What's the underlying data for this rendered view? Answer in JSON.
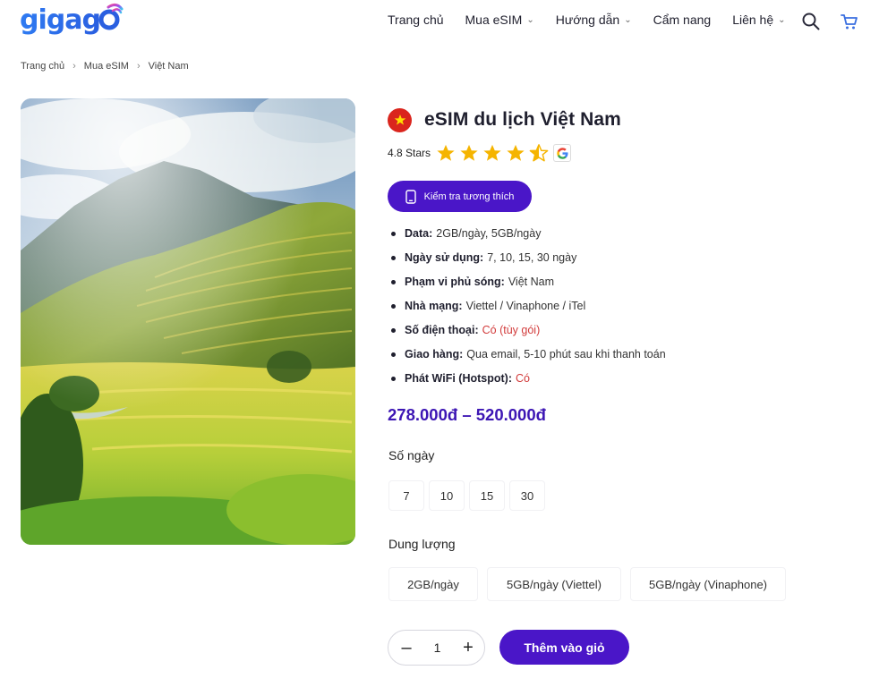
{
  "brand": {
    "logo_text": "gigago",
    "accent": "#4a16c8",
    "logo_color": "#2a6cf0"
  },
  "nav": {
    "items": [
      {
        "label": "Trang chủ",
        "has_dropdown": false
      },
      {
        "label": "Mua eSIM",
        "has_dropdown": true
      },
      {
        "label": "Hướng dẫn",
        "has_dropdown": true
      },
      {
        "label": "Cẩm nang",
        "has_dropdown": false
      },
      {
        "label": "Liên hệ",
        "has_dropdown": true
      }
    ],
    "icons": [
      "search-icon",
      "cart-icon"
    ]
  },
  "breadcrumb": [
    "Trang chủ",
    "Mua eSIM",
    "Việt Nam"
  ],
  "product": {
    "title": "eSIM du lịch Việt Nam",
    "flag": "vietnam-flag-icon",
    "rating_text": "4.8 Stars",
    "rating": 4.8,
    "compat_button": "Kiểm tra tương thích",
    "specs": [
      {
        "label": "Data:",
        "value": "2GB/ngày, 5GB/ngày",
        "highlight": false
      },
      {
        "label": "Ngày sử dụng:",
        "value": "7, 10, 15, 30 ngày",
        "highlight": false
      },
      {
        "label": "Phạm vi phủ sóng:",
        "value": "Việt Nam",
        "highlight": false
      },
      {
        "label": "Nhà mạng:",
        "value": "Viettel / Vinaphone / iTel",
        "highlight": false
      },
      {
        "label": "Số điện thoại:",
        "value": "Có (tùy gói)",
        "highlight": true
      },
      {
        "label": "Giao hàng:",
        "value": "Qua email, 5-10 phút sau khi thanh toán",
        "highlight": false
      },
      {
        "label": "Phát WiFi (Hotspot):",
        "value": "Có",
        "highlight": true
      }
    ],
    "price": "278.000đ – 520.000đ",
    "days_label": "Số ngày",
    "days_options": [
      "7",
      "10",
      "15",
      "30"
    ],
    "capacity_label": "Dung lượng",
    "capacity_options": [
      "2GB/ngày",
      "5GB/ngày (Viettel)",
      "5GB/ngày (Vinaphone)"
    ],
    "quantity": "1",
    "qty_minus": "–",
    "qty_plus": "+",
    "add_to_cart": "Thêm vào giỏ"
  }
}
